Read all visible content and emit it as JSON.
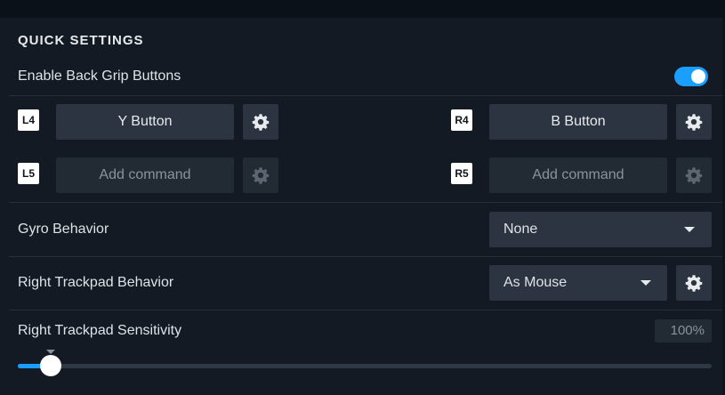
{
  "section": {
    "title": "QUICK SETTINGS"
  },
  "back_grip": {
    "label": "Enable Back Grip Buttons",
    "enabled": true,
    "left": [
      {
        "badge": "L4",
        "command": "Y Button"
      },
      {
        "badge": "L5",
        "command": "Add command"
      }
    ],
    "right": [
      {
        "badge": "R4",
        "command": "B Button"
      },
      {
        "badge": "R5",
        "command": "Add command"
      }
    ]
  },
  "gyro": {
    "label": "Gyro Behavior",
    "value": "None"
  },
  "trackpad": {
    "label": "Right Trackpad Behavior",
    "value": "As Mouse"
  },
  "sensitivity": {
    "label": "Right Trackpad Sensitivity",
    "value_text": "100%",
    "level": 0.047
  },
  "colors": {
    "accent": "#1a9fff",
    "panel": "#131a23",
    "button": "#2b3440",
    "button_disabled": "#222a34"
  },
  "icons": [
    "gear-icon",
    "chevron-down-icon"
  ]
}
